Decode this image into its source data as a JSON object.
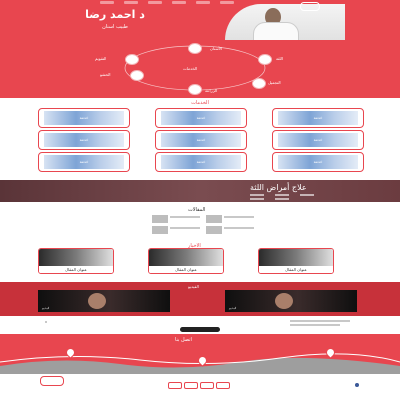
{
  "brand": {
    "color_primary": "#e8464f",
    "color_dark": "#c7313a"
  },
  "header": {
    "title": "د احمد رضا",
    "subtitle": "طبيب أسنان",
    "logo_icon": "tooth-logo-icon"
  },
  "diagram": {
    "center": "الخدمات",
    "nodes": [
      "الأسنان",
      "اللثة",
      "التجميل",
      "الزراعة",
      "التقويم",
      "الحشو"
    ]
  },
  "grid": {
    "title": "الخدمات",
    "cards": [
      "خدمة",
      "خدمة",
      "خدمة",
      "خدمة",
      "خدمة",
      "خدمة",
      "خدمة",
      "خدمة",
      "خدمة"
    ]
  },
  "band": {
    "title": "علاج أمراض اللثة"
  },
  "list": {
    "title": "المقالات"
  },
  "articles": {
    "title": "الأخبار",
    "cards": [
      "عنوان المقال",
      "عنوان المقال",
      "عنوان المقال"
    ]
  },
  "videos": {
    "title": "الفيديو",
    "captions": [
      "فيديو",
      "فيديو"
    ]
  },
  "contact": {
    "title": "اتصل بنا"
  },
  "footer": {
    "logo_icon": "tooth-logo-icon",
    "social_icon": "facebook-icon"
  }
}
